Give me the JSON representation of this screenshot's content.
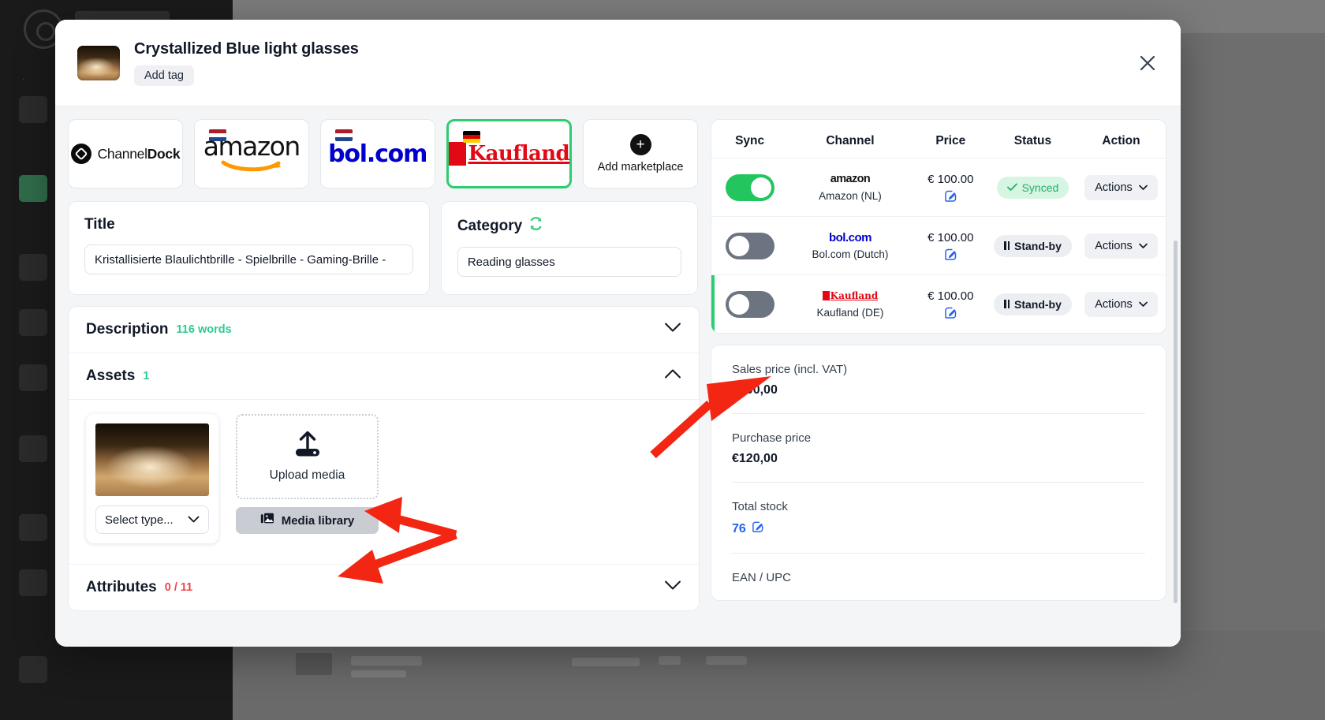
{
  "modal": {
    "title": "Crystallized Blue light glasses",
    "add_tag_label": "Add tag",
    "close_icon": "close-icon"
  },
  "marketplaces": [
    {
      "id": "channeldock",
      "name_prefix": "Channel",
      "name_suffix": "Dock",
      "flag": "",
      "selected": false
    },
    {
      "id": "amazon",
      "label": "amazon",
      "flag": "nl",
      "selected": false
    },
    {
      "id": "bolcom",
      "label": "bol.com",
      "flag": "nl",
      "selected": false
    },
    {
      "id": "kaufland",
      "label": "Kaufland",
      "flag": "de",
      "selected": true
    },
    {
      "id": "add",
      "label": "Add marketplace",
      "flag": "",
      "selected": false
    }
  ],
  "title_card": {
    "label": "Title",
    "value": "Kristallisierte Blaulichtbrille - Spielbrille - Gaming-Brille -"
  },
  "category_card": {
    "label": "Category",
    "refresh_icon": "refresh-icon",
    "value": "Reading glasses"
  },
  "accordions": {
    "description": {
      "title": "Description",
      "count": "116 words",
      "expanded": false
    },
    "assets": {
      "title": "Assets",
      "count": "1",
      "expanded": true
    },
    "attributes": {
      "title": "Attributes",
      "count": "0 / 11",
      "expanded": false
    }
  },
  "assets": {
    "select_type_placeholder": "Select type...",
    "dropzone_label": "Upload media",
    "media_library_label": "Media library"
  },
  "channels_table": {
    "headers": [
      "Sync",
      "Channel",
      "Price",
      "Status",
      "Action"
    ],
    "rows": [
      {
        "sync_on": true,
        "logo": "amazon",
        "channel": "Amazon (NL)",
        "price": "€ 100.00",
        "status": "Synced",
        "status_type": "synced",
        "action": "Actions",
        "highlight": false
      },
      {
        "sync_on": false,
        "logo": "bolcom",
        "channel": "Bol.com (Dutch)",
        "price": "€ 100.00",
        "status": "Stand-by",
        "status_type": "standby",
        "action": "Actions",
        "highlight": false
      },
      {
        "sync_on": false,
        "logo": "kaufland",
        "channel": "Kaufland (DE)",
        "price": "€ 100.00",
        "status": "Stand-by",
        "status_type": "standby",
        "action": "Actions",
        "highlight": true
      }
    ]
  },
  "details": [
    {
      "label": "Sales price (incl. VAT)",
      "value": "€100,00",
      "link": false
    },
    {
      "label": "Purchase price",
      "value": "€120,00",
      "link": false
    },
    {
      "label": "Total stock",
      "value": "76",
      "link": true
    },
    {
      "label": "EAN / UPC",
      "value": "",
      "link": false
    }
  ],
  "colors": {
    "accent_green": "#2ecc71",
    "toggle_on": "#22c55e",
    "toggle_off": "#6b7480",
    "link_blue": "#2563eb",
    "danger_red": "#ef4444",
    "annotation_red": "#f22613"
  }
}
